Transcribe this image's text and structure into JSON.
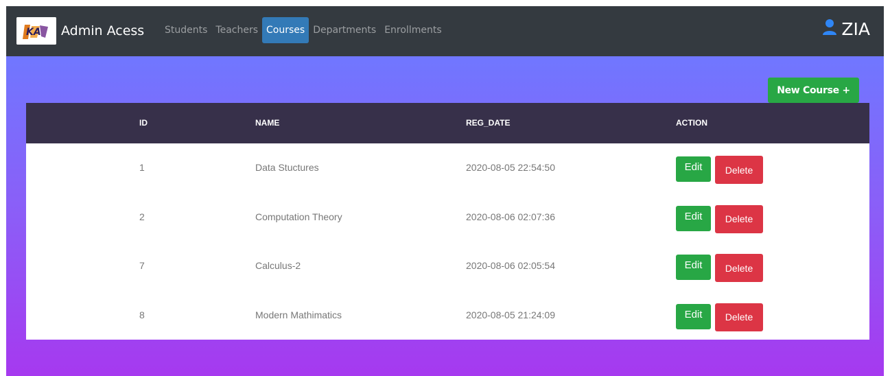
{
  "navbar": {
    "brand": "Admin Acess",
    "links": [
      "Students",
      "Teachers",
      "Courses",
      "Departments",
      "Enrollments"
    ],
    "active_link": "Courses",
    "user_name": "ZIA",
    "user_icon": "user-icon",
    "logo_text": "KA"
  },
  "page": {
    "new_button_label": "New Course +"
  },
  "table": {
    "headers": [
      "ID",
      "NAME",
      "REG_DATE",
      "ACTION"
    ],
    "rows": [
      {
        "id": "1",
        "name": "Data Stuctures",
        "reg_date": "2020-08-05 22:54:50",
        "edit": "Edit",
        "delete": "Delete"
      },
      {
        "id": "2",
        "name": "Computation Theory",
        "reg_date": "2020-08-06 02:07:36",
        "edit": "Edit",
        "delete": "Delete"
      },
      {
        "id": "7",
        "name": "Calculus-2",
        "reg_date": "2020-08-06 02:05:54",
        "edit": "Edit",
        "delete": "Delete"
      },
      {
        "id": "8",
        "name": "Modern Mathimatics",
        "reg_date": "2020-08-05 21:24:09",
        "edit": "Edit",
        "delete": "Delete"
      }
    ]
  },
  "colors": {
    "navbar": "#343a40",
    "active": "#337ab7",
    "success": "#28a745",
    "danger": "#dc3545",
    "table_header": "#37304a",
    "gradient_top": "#7077ff",
    "gradient_bottom": "#a639ef"
  }
}
